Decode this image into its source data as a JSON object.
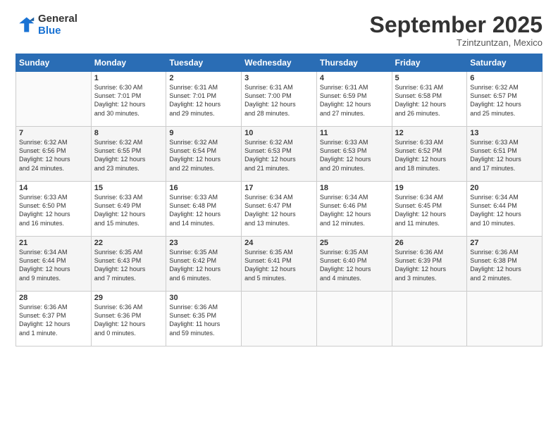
{
  "header": {
    "logo": {
      "line1": "General",
      "line2": "Blue"
    },
    "title": "September 2025",
    "location": "Tzintzuntzan, Mexico"
  },
  "weekdays": [
    "Sunday",
    "Monday",
    "Tuesday",
    "Wednesday",
    "Thursday",
    "Friday",
    "Saturday"
  ],
  "weeks": [
    [
      {
        "day": "",
        "info": ""
      },
      {
        "day": "1",
        "info": "Sunrise: 6:30 AM\nSunset: 7:01 PM\nDaylight: 12 hours\nand 30 minutes."
      },
      {
        "day": "2",
        "info": "Sunrise: 6:31 AM\nSunset: 7:01 PM\nDaylight: 12 hours\nand 29 minutes."
      },
      {
        "day": "3",
        "info": "Sunrise: 6:31 AM\nSunset: 7:00 PM\nDaylight: 12 hours\nand 28 minutes."
      },
      {
        "day": "4",
        "info": "Sunrise: 6:31 AM\nSunset: 6:59 PM\nDaylight: 12 hours\nand 27 minutes."
      },
      {
        "day": "5",
        "info": "Sunrise: 6:31 AM\nSunset: 6:58 PM\nDaylight: 12 hours\nand 26 minutes."
      },
      {
        "day": "6",
        "info": "Sunrise: 6:32 AM\nSunset: 6:57 PM\nDaylight: 12 hours\nand 25 minutes."
      }
    ],
    [
      {
        "day": "7",
        "info": "Sunrise: 6:32 AM\nSunset: 6:56 PM\nDaylight: 12 hours\nand 24 minutes."
      },
      {
        "day": "8",
        "info": "Sunrise: 6:32 AM\nSunset: 6:55 PM\nDaylight: 12 hours\nand 23 minutes."
      },
      {
        "day": "9",
        "info": "Sunrise: 6:32 AM\nSunset: 6:54 PM\nDaylight: 12 hours\nand 22 minutes."
      },
      {
        "day": "10",
        "info": "Sunrise: 6:32 AM\nSunset: 6:53 PM\nDaylight: 12 hours\nand 21 minutes."
      },
      {
        "day": "11",
        "info": "Sunrise: 6:33 AM\nSunset: 6:53 PM\nDaylight: 12 hours\nand 20 minutes."
      },
      {
        "day": "12",
        "info": "Sunrise: 6:33 AM\nSunset: 6:52 PM\nDaylight: 12 hours\nand 18 minutes."
      },
      {
        "day": "13",
        "info": "Sunrise: 6:33 AM\nSunset: 6:51 PM\nDaylight: 12 hours\nand 17 minutes."
      }
    ],
    [
      {
        "day": "14",
        "info": "Sunrise: 6:33 AM\nSunset: 6:50 PM\nDaylight: 12 hours\nand 16 minutes."
      },
      {
        "day": "15",
        "info": "Sunrise: 6:33 AM\nSunset: 6:49 PM\nDaylight: 12 hours\nand 15 minutes."
      },
      {
        "day": "16",
        "info": "Sunrise: 6:33 AM\nSunset: 6:48 PM\nDaylight: 12 hours\nand 14 minutes."
      },
      {
        "day": "17",
        "info": "Sunrise: 6:34 AM\nSunset: 6:47 PM\nDaylight: 12 hours\nand 13 minutes."
      },
      {
        "day": "18",
        "info": "Sunrise: 6:34 AM\nSunset: 6:46 PM\nDaylight: 12 hours\nand 12 minutes."
      },
      {
        "day": "19",
        "info": "Sunrise: 6:34 AM\nSunset: 6:45 PM\nDaylight: 12 hours\nand 11 minutes."
      },
      {
        "day": "20",
        "info": "Sunrise: 6:34 AM\nSunset: 6:44 PM\nDaylight: 12 hours\nand 10 minutes."
      }
    ],
    [
      {
        "day": "21",
        "info": "Sunrise: 6:34 AM\nSunset: 6:44 PM\nDaylight: 12 hours\nand 9 minutes."
      },
      {
        "day": "22",
        "info": "Sunrise: 6:35 AM\nSunset: 6:43 PM\nDaylight: 12 hours\nand 7 minutes."
      },
      {
        "day": "23",
        "info": "Sunrise: 6:35 AM\nSunset: 6:42 PM\nDaylight: 12 hours\nand 6 minutes."
      },
      {
        "day": "24",
        "info": "Sunrise: 6:35 AM\nSunset: 6:41 PM\nDaylight: 12 hours\nand 5 minutes."
      },
      {
        "day": "25",
        "info": "Sunrise: 6:35 AM\nSunset: 6:40 PM\nDaylight: 12 hours\nand 4 minutes."
      },
      {
        "day": "26",
        "info": "Sunrise: 6:36 AM\nSunset: 6:39 PM\nDaylight: 12 hours\nand 3 minutes."
      },
      {
        "day": "27",
        "info": "Sunrise: 6:36 AM\nSunset: 6:38 PM\nDaylight: 12 hours\nand 2 minutes."
      }
    ],
    [
      {
        "day": "28",
        "info": "Sunrise: 6:36 AM\nSunset: 6:37 PM\nDaylight: 12 hours\nand 1 minute."
      },
      {
        "day": "29",
        "info": "Sunrise: 6:36 AM\nSunset: 6:36 PM\nDaylight: 12 hours\nand 0 minutes."
      },
      {
        "day": "30",
        "info": "Sunrise: 6:36 AM\nSunset: 6:35 PM\nDaylight: 11 hours\nand 59 minutes."
      },
      {
        "day": "",
        "info": ""
      },
      {
        "day": "",
        "info": ""
      },
      {
        "day": "",
        "info": ""
      },
      {
        "day": "",
        "info": ""
      }
    ]
  ]
}
